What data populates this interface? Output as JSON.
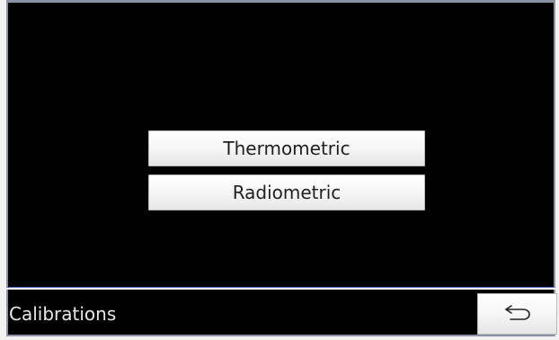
{
  "menu": {
    "buttons": [
      {
        "label": "Thermometric"
      },
      {
        "label": "Radiometric"
      }
    ]
  },
  "footer": {
    "title": "Calibrations",
    "back_icon": "back-arrow-icon"
  },
  "colors": {
    "background": "#000000",
    "button_face": "#f5f5f5",
    "text_light": "#e8e8e8",
    "frame": "#8a93a6"
  }
}
